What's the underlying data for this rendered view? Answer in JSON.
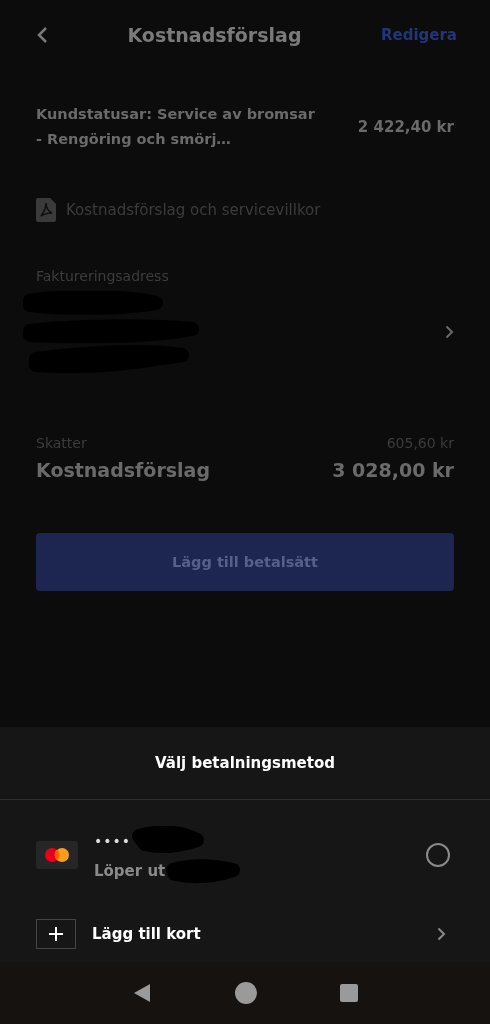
{
  "header": {
    "title": "Kostnadsförslag",
    "action": "Redigera"
  },
  "line_item": {
    "description": "Kundstatusar: Service av bromsar - Rengöring och smörj…",
    "amount": "2 422,40 kr"
  },
  "document_link": "Kostnadsförslag och servicevillkor",
  "billing_address": {
    "label": "Faktureringsadress"
  },
  "taxes": {
    "label": "Skatter",
    "amount": "605,60 kr"
  },
  "total": {
    "label": "Kostnadsförslag",
    "amount": "3 028,00 kr"
  },
  "primary_button": "Lägg till betalsätt",
  "payment_sheet": {
    "title": "Välj betalningsmetod",
    "cards": [
      {
        "masked_number": "••••",
        "expiry_label": "Löper ut",
        "selected": false
      }
    ],
    "add_card": "Lägg till kort"
  }
}
